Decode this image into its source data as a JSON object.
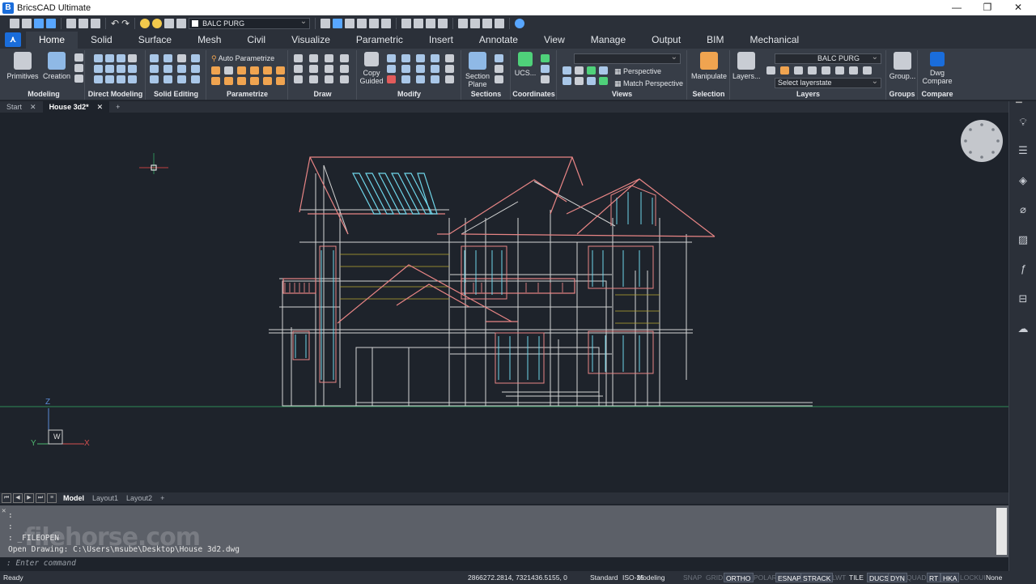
{
  "app": {
    "title": "BricsCAD Ultimate"
  },
  "quick_access": {
    "layer_combo": "BALC PURG"
  },
  "ribbon_tabs": [
    "Home",
    "Solid",
    "Surface",
    "Mesh",
    "Civil",
    "Visualize",
    "Parametric",
    "Insert",
    "Annotate",
    "View",
    "Manage",
    "Output",
    "BIM",
    "Mechanical"
  ],
  "active_tab": "Home",
  "panels": {
    "modeling": {
      "label": "Modeling",
      "primitives": "Primitives",
      "creation": "Creation"
    },
    "direct_modeling": {
      "label": "Direct Modeling"
    },
    "solid_editing": {
      "label": "Solid Editing"
    },
    "parametrize": {
      "label": "Parametrize",
      "auto": "Auto Parametrize"
    },
    "draw": {
      "label": "Draw"
    },
    "modify": {
      "label": "Modify",
      "copy_guided_1": "Copy",
      "copy_guided_2": "Guided"
    },
    "sections": {
      "label": "Sections",
      "section_plane_1": "Section",
      "section_plane_2": "Plane"
    },
    "coordinates": {
      "label": "Coordinates",
      "ucs": "UCS..."
    },
    "views": {
      "label": "Views",
      "perspective": "Perspective",
      "match_perspective": "Match Perspective"
    },
    "selection": {
      "label": "Selection",
      "manipulate": "Manipulate"
    },
    "layers": {
      "label": "Layers",
      "layers_btn": "Layers...",
      "layer_combo": "BALC PURG",
      "layerstate": "Select layerstate"
    },
    "groups": {
      "label": "Groups",
      "group_btn": "Group..."
    },
    "compare": {
      "label": "Compare",
      "dwg_compare_1": "Dwg",
      "dwg_compare_2": "Compare"
    }
  },
  "doc_tabs": {
    "start": "Start",
    "current": "House 3d2*",
    "add": "+"
  },
  "layout_tabs": [
    "Model",
    "Layout1",
    "Layout2"
  ],
  "layout_add": "+",
  "ucs_icon": {
    "z": "Z",
    "y": "Y",
    "x": "X",
    "w": "W"
  },
  "command_history": [
    ":",
    ":",
    ": _FILEOPEN",
    "Open Drawing: C:\\Users\\msube\\Desktop\\House 3d2.dwg"
  ],
  "command_prompt": ": Enter command",
  "watermark": "filehorse.com",
  "status": {
    "ready": "Ready",
    "coords": "2866272.2814, 7321436.5155, 0",
    "items": [
      {
        "label": "Standard",
        "state": "mid"
      },
      {
        "label": "ISO-25",
        "state": "mid"
      },
      {
        "label": "Modeling",
        "state": "mid"
      },
      {
        "label": "SNAP",
        "state": "off"
      },
      {
        "label": "GRID",
        "state": "off"
      },
      {
        "label": "ORTHO",
        "state": "on"
      },
      {
        "label": "POLAR",
        "state": "off"
      },
      {
        "label": "ESNAP",
        "state": "on"
      },
      {
        "label": "STRACK",
        "state": "on"
      },
      {
        "label": "LWT",
        "state": "off"
      },
      {
        "label": "TILE",
        "state": "mid"
      },
      {
        "label": "DUCS",
        "state": "on"
      },
      {
        "label": "DYN",
        "state": "on"
      },
      {
        "label": "QUAD",
        "state": "off"
      },
      {
        "label": "RT",
        "state": "on"
      },
      {
        "label": "HKA",
        "state": "on"
      },
      {
        "label": "LOCKUI",
        "state": "off"
      },
      {
        "label": "None",
        "state": "mid"
      }
    ]
  }
}
